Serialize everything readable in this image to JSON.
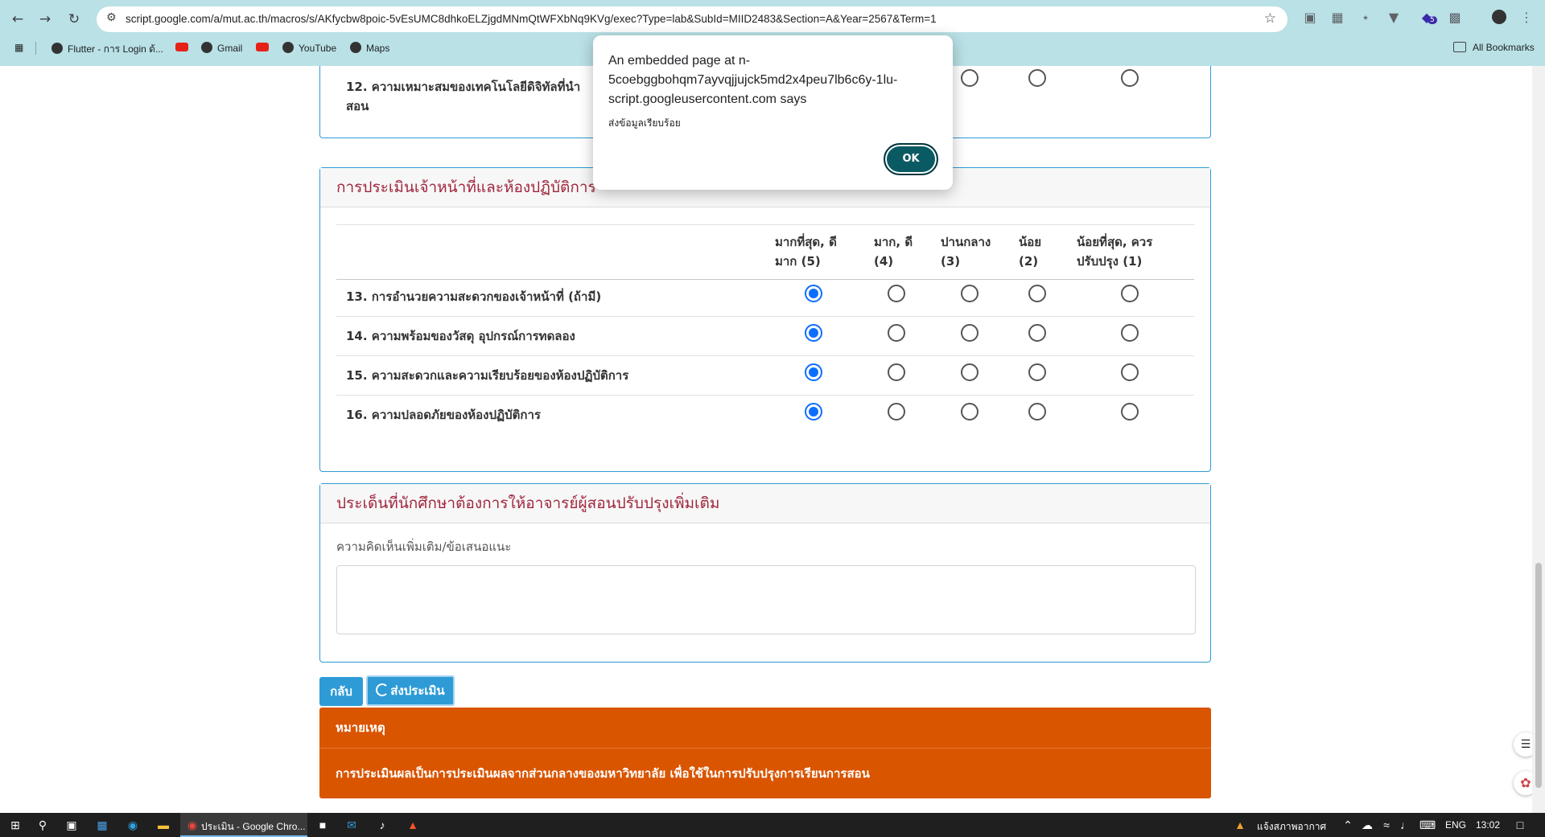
{
  "browser": {
    "url": "script.google.com/a/mut.ac.th/macros/s/AKfycbw8poic-5vEsUMC8dhkoELZjgdMNmQtWFXbNq9KVg/exec?Type=lab&SubId=MIID2483&Section=A&Year=2567&Term=1",
    "bookmarks": [
      "Flutter - การ Login ด้...",
      "Gmail",
      "YouTube",
      "Maps"
    ],
    "all_bookmarks": "All Bookmarks",
    "extension_badge": "5"
  },
  "dialog": {
    "title": "An embedded page at n-5coebggbohqm7ayvqjjujck5md2x4peu7lb6c6y-1lu-script.googleusercontent.com says",
    "message": "ส่งข้อมูลเรียบร้อย",
    "ok_label": "OK"
  },
  "section_prev": {
    "row12": "12. ความเหมาะสมของเทคโนโลยีดิจิทัลที่นำ",
    "row12_line2": "สอน"
  },
  "section_lab": {
    "title": "การประเมินเจ้าหน้าที่และห้องปฏิบัติการ",
    "columns": [
      {
        "line1": "มากที่สุด, ดี",
        "line2": "มาก (5)"
      },
      {
        "line1": "มาก, ดี",
        "line2": "(4)"
      },
      {
        "line1": "ปานกลาง",
        "line2": "(3)"
      },
      {
        "line1": "น้อย",
        "line2": "(2)"
      },
      {
        "line1": "น้อยที่สุด, ควร",
        "line2": "ปรับปรุง (1)"
      }
    ],
    "rows": [
      "13. การอำนวยความสะดวกของเจ้าหน้าที่ (ถ้ามี)",
      "14. ความพร้อมของวัสดุ อุปกรณ์การทดลอง",
      "15. ความสะดวกและความเรียบร้อยของห้องปฏิบัติการ",
      "16. ความปลอดภัยของห้องปฏิบัติการ"
    ],
    "selected_score": 5
  },
  "section_comment": {
    "title": "ประเด็นที่นักศึกษาต้องการให้อาจารย์ผู้สอนปรับปรุงเพิ่มเติม",
    "label": "ความคิดเห็นเพิ่มเติม/ข้อเสนอแนะ",
    "value": ""
  },
  "buttons": {
    "back": "กลับ",
    "submit": "ส่งประเมิน"
  },
  "notice": {
    "title": "หมายเหตุ",
    "body": "การประเมินผลเป็นการประเมินผลจากส่วนกลางของมหาวิทยาลัย เพื่อใช้ในการปรับปรุงการเรียนการสอน"
  },
  "taskbar": {
    "active_window": "ประเมิน - Google Chro...",
    "weather": "แจ้งสภาพอากาศ",
    "language": "ENG",
    "time": "13:02"
  },
  "colors": {
    "accent": "#2e9bd6",
    "header_text": "#a0263c",
    "notice_bg": "#d95500",
    "radio_checked": "#0d6efd",
    "chrome_bg": "#b9e1e6"
  }
}
